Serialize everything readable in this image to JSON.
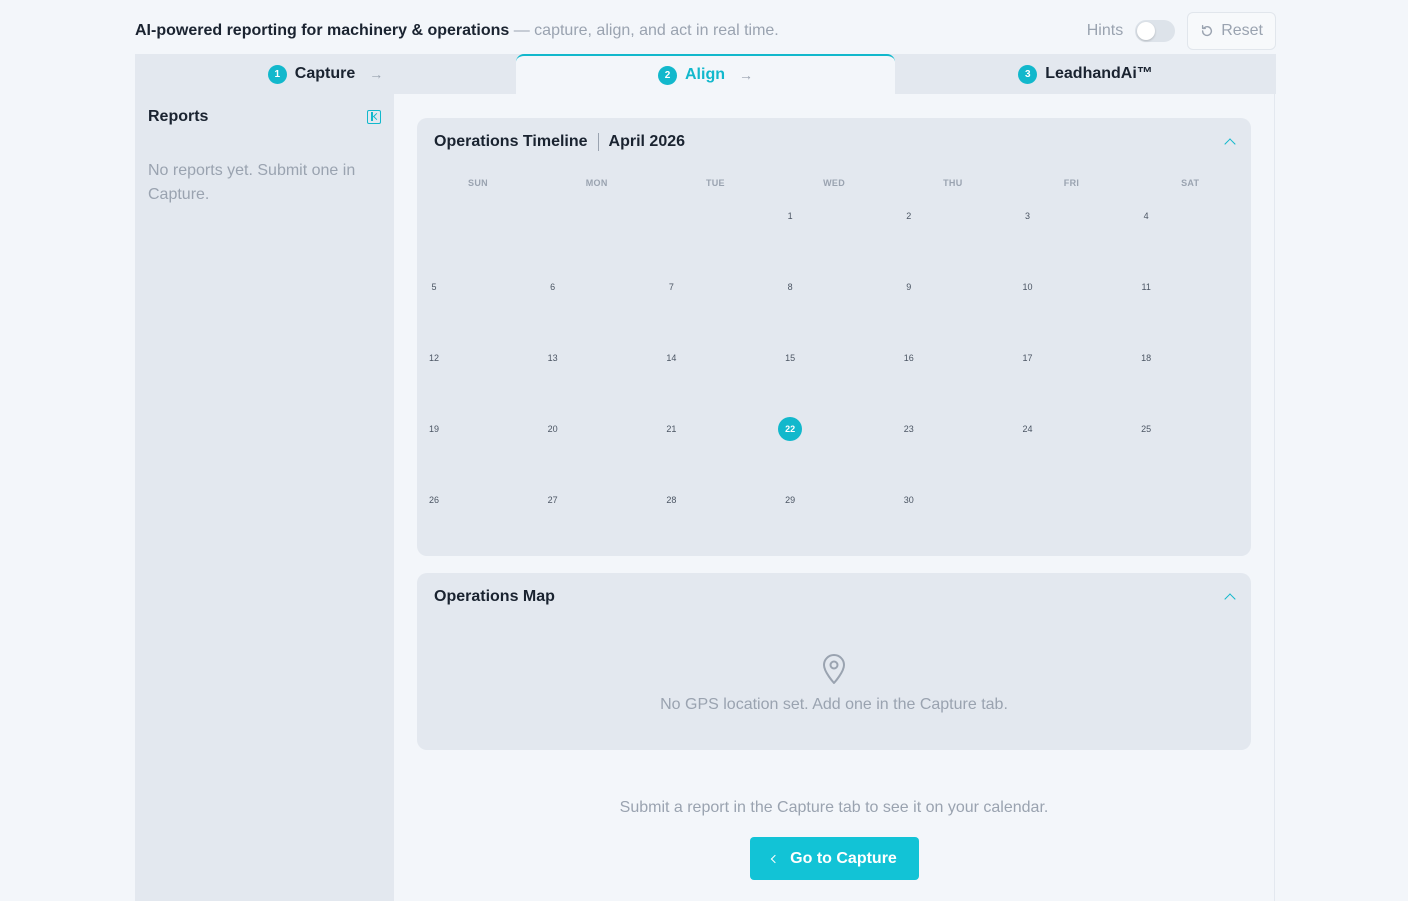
{
  "header": {
    "tagline_strong": "AI-powered reporting for machinery & operations",
    "tagline_muted": " — capture, align, and act in real time.",
    "hints_label": "Hints",
    "hints_on": false,
    "reset_label": "Reset"
  },
  "tabs": [
    {
      "step": "1",
      "label": "Capture",
      "active": false,
      "arrow": "→"
    },
    {
      "step": "2",
      "label": "Align",
      "active": true,
      "arrow": "→"
    },
    {
      "step": "3",
      "label": "LeadhandAi™",
      "active": false
    }
  ],
  "sidebar": {
    "title": "Reports",
    "empty_text": "No reports yet. Submit one in Capture."
  },
  "calendar": {
    "title": "Operations Timeline",
    "month": "April 2026",
    "weekdays": [
      "SUN",
      "MON",
      "TUE",
      "WED",
      "THU",
      "FRI",
      "SAT"
    ],
    "first_weekday_index": 3,
    "days_in_month": 30,
    "today": 22
  },
  "map": {
    "title": "Operations Map",
    "empty_text": "No GPS location set. Add one in the Capture tab."
  },
  "cta": {
    "text": "Submit a report in the Capture tab to see it on your calendar.",
    "button_label": "Go to Capture"
  },
  "colors": {
    "accent": "#12b8cc",
    "muted_text": "#9aa3b0",
    "panel": "#e3e8ef"
  }
}
